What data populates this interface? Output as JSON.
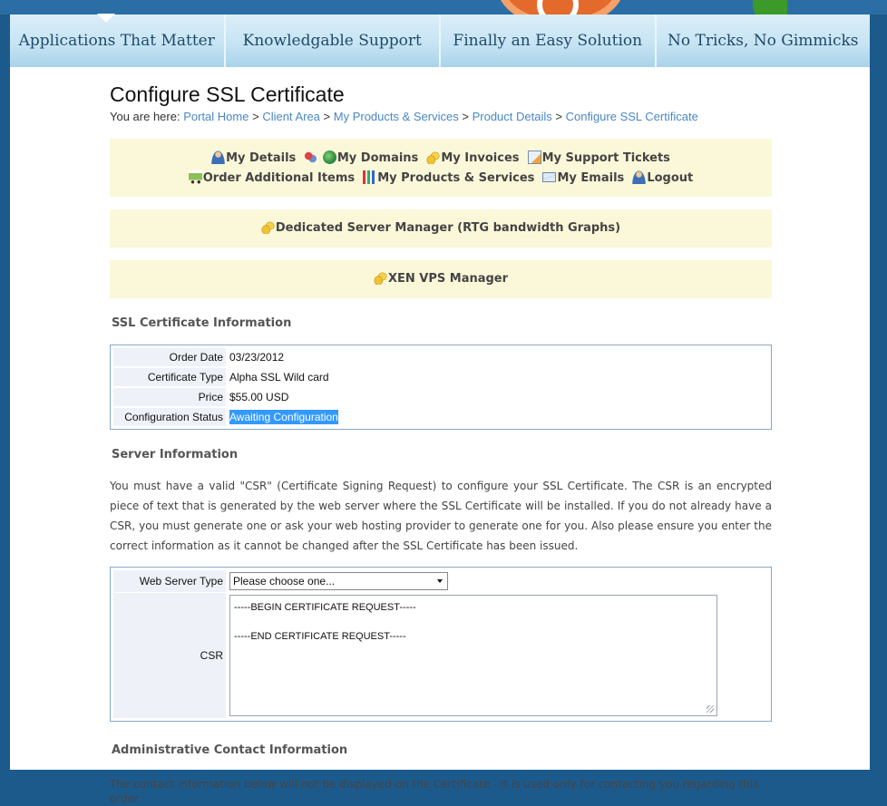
{
  "nav": {
    "items": [
      {
        "label": "Applications That Matter"
      },
      {
        "label": "Knowledgable Support"
      },
      {
        "label": "Finally an Easy Solution"
      },
      {
        "label": "No Tricks, No Gimmicks"
      }
    ]
  },
  "page": {
    "title": "Configure SSL Certificate",
    "breadcrumb": {
      "prefix": "You are here:",
      "links": [
        "Portal Home",
        "Client Area",
        "My Products & Services",
        "Product Details",
        "Configure SSL Certificate"
      ],
      "separator": ">"
    }
  },
  "menu": {
    "row1": [
      "My Details",
      "My Domains",
      "My Invoices",
      "My Support Tickets"
    ],
    "row2": [
      "Order Additional Items",
      "My Products & Services",
      "My Emails",
      "Logout"
    ],
    "dedicated": "Dedicated Server Manager (RTG bandwidth Graphs)",
    "xen": "XEN VPS Manager"
  },
  "ssl_info": {
    "heading": "SSL Certificate Information",
    "rows": [
      {
        "label": "Order Date",
        "value": "03/23/2012"
      },
      {
        "label": "Certificate Type",
        "value": "Alpha SSL Wild card"
      },
      {
        "label": "Price",
        "value": "$55.00 USD"
      },
      {
        "label": "Configuration Status",
        "value": "Awaiting Configuration"
      }
    ]
  },
  "server_info": {
    "heading": "Server Information",
    "paragraph": "You must have a valid \"CSR\" (Certificate Signing Request) to configure your SSL Certificate. The CSR is an encrypted piece of text that is generated by the web server where the SSL Certificate will be installed. If you do not already have a CSR, you must generate one or ask your web hosting provider to generate one for you. Also please ensure you enter the correct information as it cannot be changed after the SSL Certificate has been issued.",
    "web_server_label": "Web Server Type",
    "web_server_value": "Please choose one...",
    "csr_label": "CSR",
    "csr_value": "-----BEGIN CERTIFICATE REQUEST-----\n\n-----END CERTIFICATE REQUEST-----"
  },
  "admin_contact": {
    "heading": "Administrative Contact Information",
    "paragraph": "The contact information below will not be displayed on the Certificate - it is used only for contacting you regarding this order."
  },
  "colors": {
    "accent_link": "#4a87c6",
    "menu_bg": "#fbf8d9",
    "highlight": "#3399ff"
  }
}
